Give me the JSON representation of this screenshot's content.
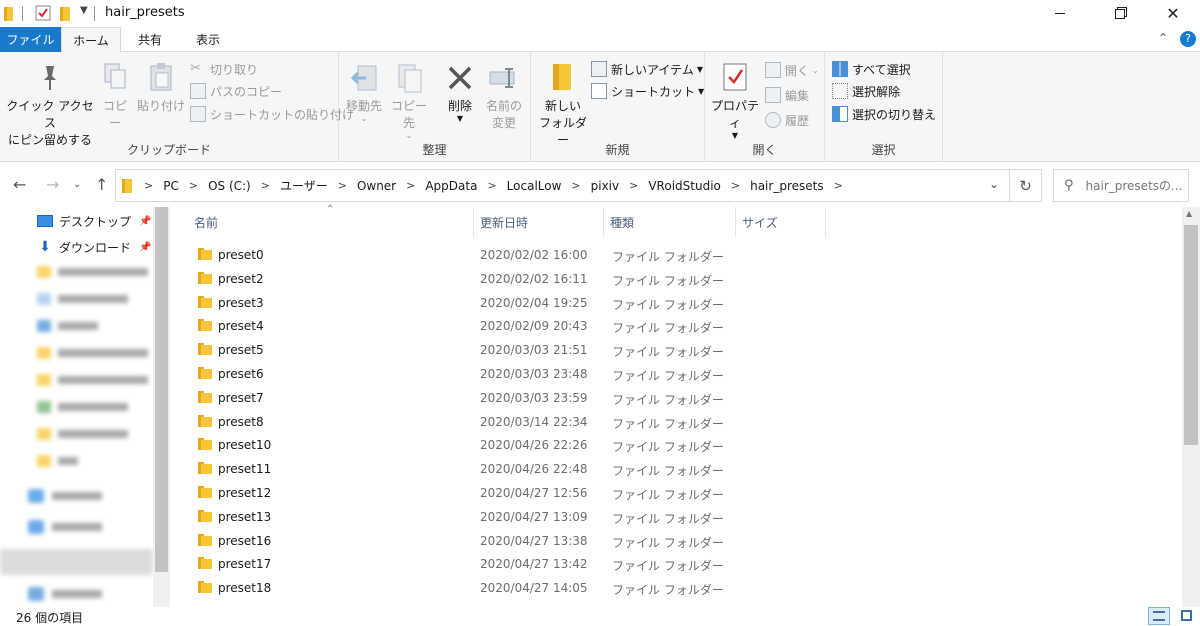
{
  "window": {
    "title": "hair_presets",
    "controls": [
      "minimize",
      "maximize",
      "close"
    ]
  },
  "ribbon_tabs": [
    {
      "label": "ファイル"
    },
    {
      "label": "ホーム"
    },
    {
      "label": "共有"
    },
    {
      "label": "表示"
    }
  ],
  "ribbon": {
    "clipboard": {
      "label": "クリップボード",
      "pin_quick_access": "クイック アクセス\nにピン留めする",
      "pin_line1": "クイック アクセス",
      "pin_line2": "にピン留めする",
      "copy": "コピー",
      "paste": "貼り付け",
      "cut": "切り取り",
      "copy_path": "パスのコピー",
      "paste_shortcut": "ショートカットの貼り付け"
    },
    "organize": {
      "label": "整理",
      "move_to": "移動先",
      "copy_to": "コピー先",
      "delete": "削除",
      "rename_line1": "名前の",
      "rename_line2": "変更"
    },
    "new": {
      "label": "新規",
      "new_folder_line1": "新しい",
      "new_folder_line2": "フォルダー",
      "new_item": "新しいアイテム",
      "shortcut": "ショートカット"
    },
    "open": {
      "label": "開く",
      "properties": "プロパティ",
      "open": "開く",
      "edit": "編集",
      "history": "履歴"
    },
    "select": {
      "label": "選択",
      "select_all": "すべて選択",
      "select_none": "選択解除",
      "invert_selection": "選択の切り替え"
    }
  },
  "address": {
    "crumbs": [
      "PC",
      "OS (C:)",
      "ユーザー",
      "Owner",
      "AppData",
      "LocalLow",
      "pixiv",
      "VRoidStudio",
      "hair_presets"
    ],
    "search_placeholder": "hair_presetsの..."
  },
  "nav_pane": {
    "items": [
      {
        "label": "デスクトップ",
        "pinned": true
      },
      {
        "label": "ダウンロード",
        "pinned": true
      }
    ]
  },
  "columns": {
    "name": "名前",
    "date": "更新日時",
    "type": "種類",
    "size": "サイズ"
  },
  "files": [
    {
      "name": "preset0",
      "date": "2020/02/02 16:00",
      "type": "ファイル フォルダー"
    },
    {
      "name": "preset2",
      "date": "2020/02/02 16:11",
      "type": "ファイル フォルダー"
    },
    {
      "name": "preset3",
      "date": "2020/02/04 19:25",
      "type": "ファイル フォルダー"
    },
    {
      "name": "preset4",
      "date": "2020/02/09 20:43",
      "type": "ファイル フォルダー"
    },
    {
      "name": "preset5",
      "date": "2020/03/03 21:51",
      "type": "ファイル フォルダー"
    },
    {
      "name": "preset6",
      "date": "2020/03/03 23:48",
      "type": "ファイル フォルダー"
    },
    {
      "name": "preset7",
      "date": "2020/03/03 23:59",
      "type": "ファイル フォルダー"
    },
    {
      "name": "preset8",
      "date": "2020/03/14 22:34",
      "type": "ファイル フォルダー"
    },
    {
      "name": "preset10",
      "date": "2020/04/26 22:26",
      "type": "ファイル フォルダー"
    },
    {
      "name": "preset11",
      "date": "2020/04/26 22:48",
      "type": "ファイル フォルダー"
    },
    {
      "name": "preset12",
      "date": "2020/04/27 12:56",
      "type": "ファイル フォルダー"
    },
    {
      "name": "preset13",
      "date": "2020/04/27 13:09",
      "type": "ファイル フォルダー"
    },
    {
      "name": "preset16",
      "date": "2020/04/27 13:38",
      "type": "ファイル フォルダー"
    },
    {
      "name": "preset17",
      "date": "2020/04/27 13:42",
      "type": "ファイル フォルダー"
    },
    {
      "name": "preset18",
      "date": "2020/04/27 14:05",
      "type": "ファイル フォルダー"
    }
  ],
  "status": {
    "item_count": "26 個の項目"
  },
  "colors": {
    "accent": "#1979ca",
    "folder": "#f8c537",
    "folder_dark": "#e0a91f"
  }
}
